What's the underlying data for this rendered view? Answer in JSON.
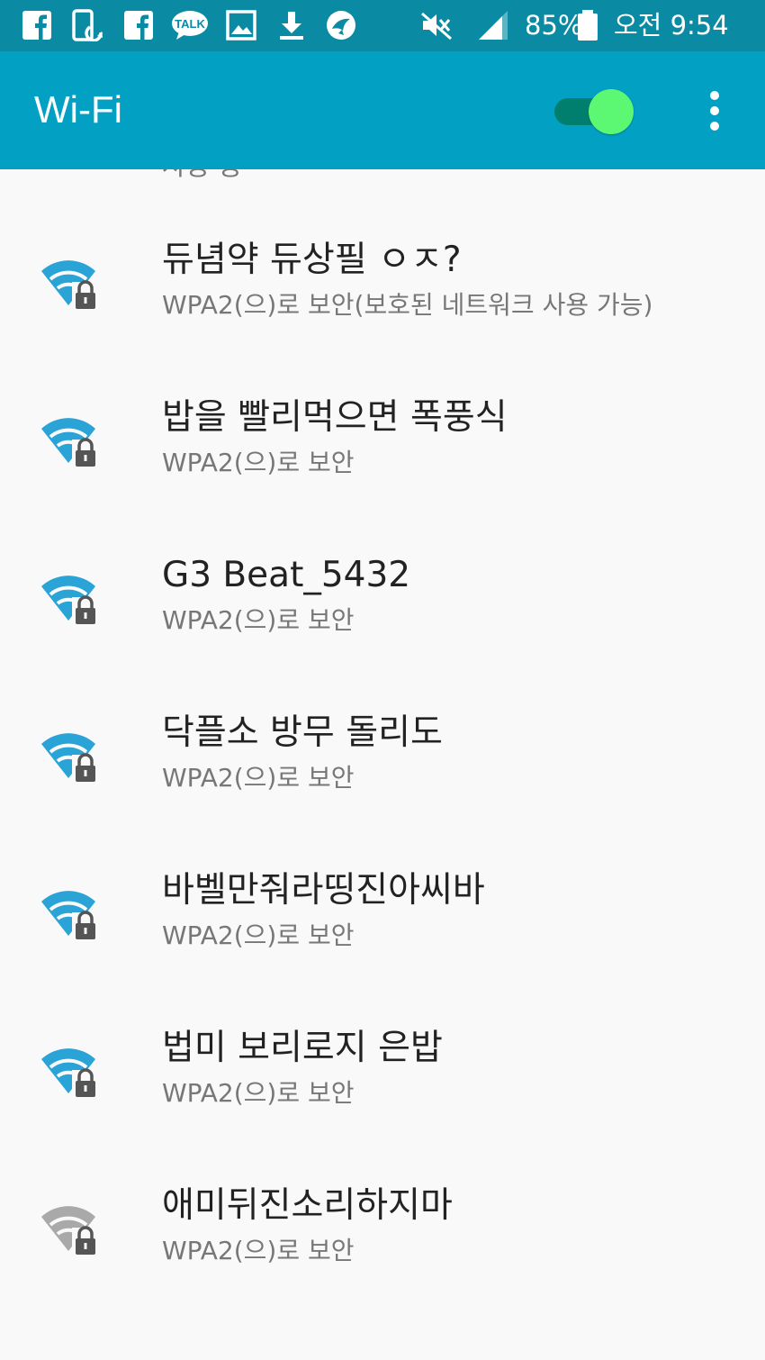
{
  "status_bar": {
    "icons": [
      "facebook-icon",
      "phone-sync-icon",
      "facebook-icon",
      "kakaotalk-icon",
      "gallery-icon",
      "download-icon",
      "bird-app-icon",
      "mute-icon",
      "signal-icon",
      "battery-icon"
    ],
    "talk_badge": "TALK",
    "battery": "85%",
    "time": "오전 9:54"
  },
  "app_bar": {
    "title": "Wi-Fi",
    "wifi_enabled": true
  },
  "list": {
    "partial_item_text": "사용 중",
    "networks": [
      {
        "ssid": "듀념약 듀상필 ㅇㅈ?",
        "security": "WPA2(으)로 보안(보호된 네트워크 사용 가능)",
        "signal": "strong"
      },
      {
        "ssid": "밥을 빨리먹으면 폭풍식",
        "security": "WPA2(으)로 보안",
        "signal": "strong"
      },
      {
        "ssid": "G3 Beat_5432",
        "security": "WPA2(으)로 보안",
        "signal": "strong"
      },
      {
        "ssid": "닥플소 방무 돌리도",
        "security": "WPA2(으)로 보안",
        "signal": "strong"
      },
      {
        "ssid": "바벨만줘라띵진아씨바",
        "security": "WPA2(으)로 보안",
        "signal": "strong"
      },
      {
        "ssid": "법미 보리로지 은밥",
        "security": "WPA2(으)로 보안",
        "signal": "strong"
      },
      {
        "ssid": "애미뒤진소리하지마",
        "security": "WPA2(으)로 보안",
        "signal": "weak"
      }
    ]
  },
  "colors": {
    "status_bar_bg": "#0a8aa3",
    "app_bar_bg": "#02a1c3",
    "wifi_active": "#2aa3d6",
    "wifi_inactive": "#a9a9a9",
    "toggle_thumb": "#5cf873",
    "toggle_track": "#007f6e"
  }
}
